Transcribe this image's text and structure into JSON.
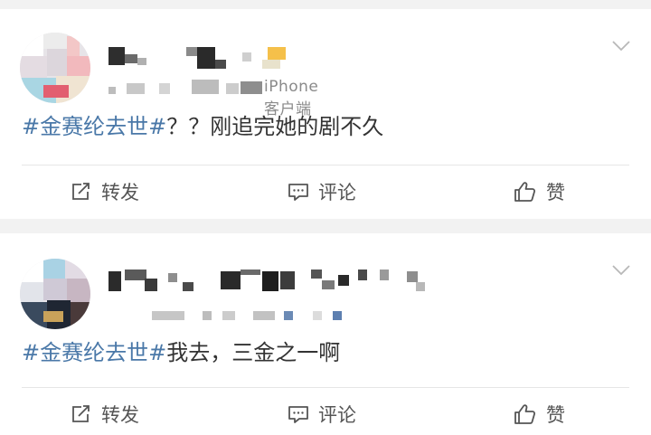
{
  "posts": [
    {
      "source": "iPhone客户端",
      "text_hashtag": "#金赛纶去世#",
      "text_body": "？？刚追完她的剧不久",
      "actions": {
        "forward": "转发",
        "comment": "评论",
        "like": "赞"
      }
    },
    {
      "source": "",
      "text_hashtag": "#金赛纶去世#",
      "text_body": "我去，三金之一啊",
      "actions": {
        "forward": "转发",
        "comment": "评论",
        "like": "赞"
      }
    }
  ],
  "colors": {
    "hashtag": "#4a78a8",
    "text": "#333333",
    "meta": "#8a8a8a",
    "background": "#f2f2f2",
    "card": "#ffffff"
  },
  "icons": {
    "menu": "chevron-down-icon",
    "forward": "share-icon",
    "comment": "comment-icon",
    "like": "thumbs-up-icon",
    "avatar": "avatar-blurred"
  }
}
